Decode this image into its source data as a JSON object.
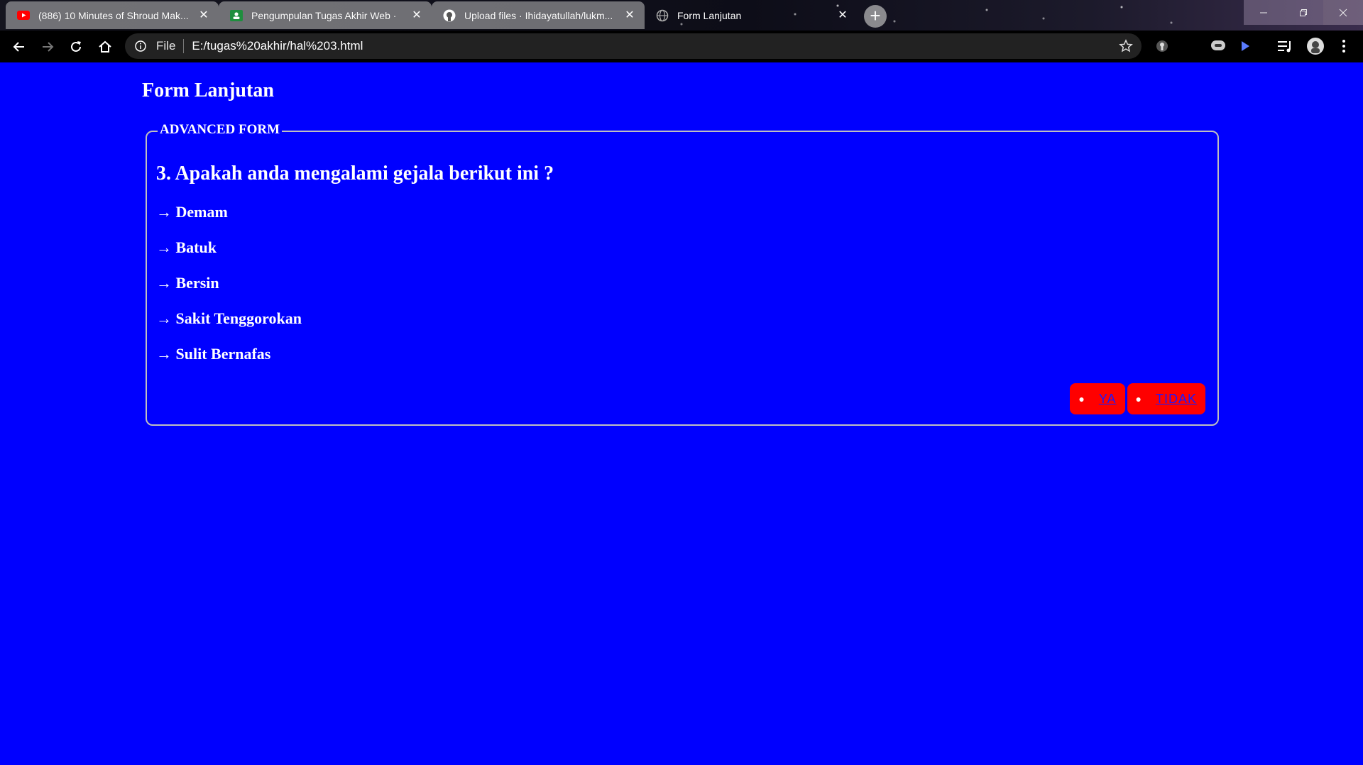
{
  "browser": {
    "tabs": [
      {
        "title": "(886) 10 Minutes of Shroud Mak...",
        "favicon": "youtube-icon"
      },
      {
        "title": "Pengumpulan Tugas Akhir Web ·",
        "favicon": "google-classroom-icon"
      },
      {
        "title": "Upload files · Ihidayatullah/lukm...",
        "favicon": "github-icon"
      },
      {
        "title": "Form Lanjutan",
        "favicon": "globe-icon"
      }
    ],
    "address": {
      "scheme": "File",
      "url": "E:/tugas%20akhir/hal%203.html"
    }
  },
  "page": {
    "title": "Form Lanjutan",
    "legend": "ADVANCED FORM",
    "question": "3. Apakah anda mengalami gejala berikut ini ?",
    "symptoms": [
      "→ Demam",
      "→ Batuk",
      "→ Bersin",
      "→ Sakit Tenggorokan",
      "→ Sulit Bernafas"
    ],
    "answers": {
      "yes": "YA",
      "no": "TIDAK"
    }
  },
  "colors": {
    "background": "#0000ff",
    "button": "#ff0000",
    "link": "#1a1aff"
  }
}
